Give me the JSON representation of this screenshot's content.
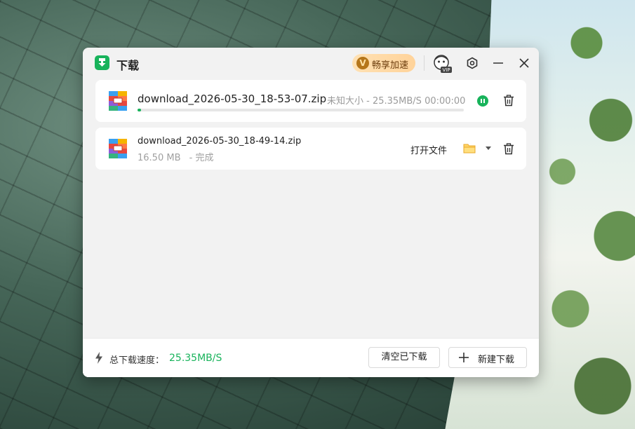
{
  "window": {
    "title": "下载",
    "vip": {
      "badge": "V",
      "label": "畅享加速"
    },
    "icons": [
      "download-app-logo",
      "vip-avatar-icon",
      "settings-icon",
      "minimize-icon",
      "close-icon"
    ]
  },
  "downloads": [
    {
      "filename": "download_2026-05-30_18-53-07.zip",
      "status_text": "未知大小 - 25.35MB/S 00:00:00",
      "progress": 0.01,
      "state": "downloading"
    },
    {
      "filename": "download_2026-05-30_18-49-14.zip",
      "size": "16.50 MB",
      "status": "- 完成",
      "open_label": "打开文件",
      "state": "completed"
    }
  ],
  "footer": {
    "total_speed_label": "总下载速度：",
    "total_speed_value": "25.35MB/S",
    "clear_button": "清空已下载",
    "new_button": "新建下载"
  },
  "colors": {
    "accent": "#18b35b",
    "vip": "#ffd39a",
    "window_bg": "#f2f2f2"
  }
}
